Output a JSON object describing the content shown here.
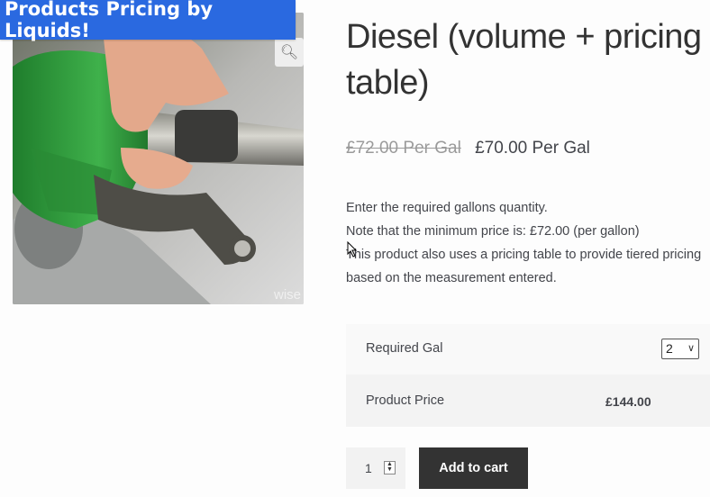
{
  "banner": {
    "text": "Products Pricing by Liquids!"
  },
  "gallery": {
    "zoom_icon": "magnifier-icon",
    "watermark": "wise"
  },
  "product": {
    "title": "Diesel (volume + pricing table)",
    "regular_price": "£72.00 Per Gal",
    "sale_price": "£70.00 Per Gal",
    "description": [
      "Enter the required gallons quantity.",
      "Note that the minimum price is: £72.00 (per gallon)",
      "This product also uses a pricing table to provide tiered pricing",
      "based on the measurement entered."
    ]
  },
  "measurement": {
    "label": "Required Gal",
    "selected": "2",
    "price_label": "Product Price",
    "price_value": "£144.00"
  },
  "cart": {
    "quantity": "1",
    "add_label": "Add to cart"
  },
  "colors": {
    "banner": "#2a69e0",
    "button": "#333333",
    "nozzle": "#2f9a3a"
  }
}
